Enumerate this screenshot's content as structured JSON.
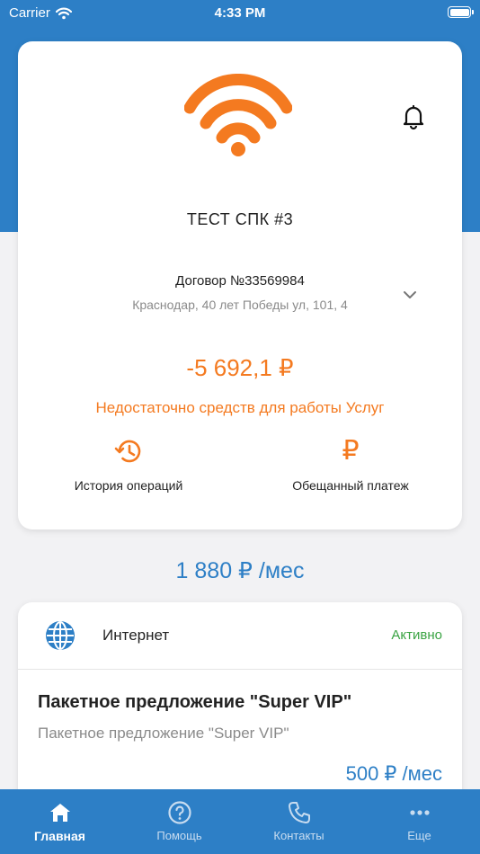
{
  "status_bar": {
    "carrier": "Carrier",
    "time": "4:33 PM"
  },
  "account": {
    "name": "ТЕСТ СПК #3",
    "contract": "Договор №33569984",
    "address": "Краснодар, 40 лет Победы ул, 101, 4",
    "balance": "-5 692,1 ₽",
    "warning": "Недостаточно средств для работы Услуг"
  },
  "actions": {
    "history_label": "История операций",
    "promise_label": "Обещанный платеж",
    "promise_glyph": "₽"
  },
  "monthly_total": "1 880 ₽ /мес",
  "service": {
    "name": "Интернет",
    "status": "Активно",
    "package_title": "Пакетное предложение \"Super VIP\"",
    "package_subtitle": "Пакетное предложение \"Super VIP\"",
    "price": "500 ₽ /мес"
  },
  "tabs": [
    {
      "label": "Главная",
      "icon": "home-icon",
      "active": true
    },
    {
      "label": "Помощь",
      "icon": "help-icon",
      "active": false
    },
    {
      "label": "Контакты",
      "icon": "phone-icon",
      "active": false
    },
    {
      "label": "Еще",
      "icon": "more-icon",
      "active": false
    }
  ],
  "colors": {
    "brand_blue": "#2d7fc6",
    "accent_orange": "#f47a20",
    "status_green": "#3aa343"
  }
}
